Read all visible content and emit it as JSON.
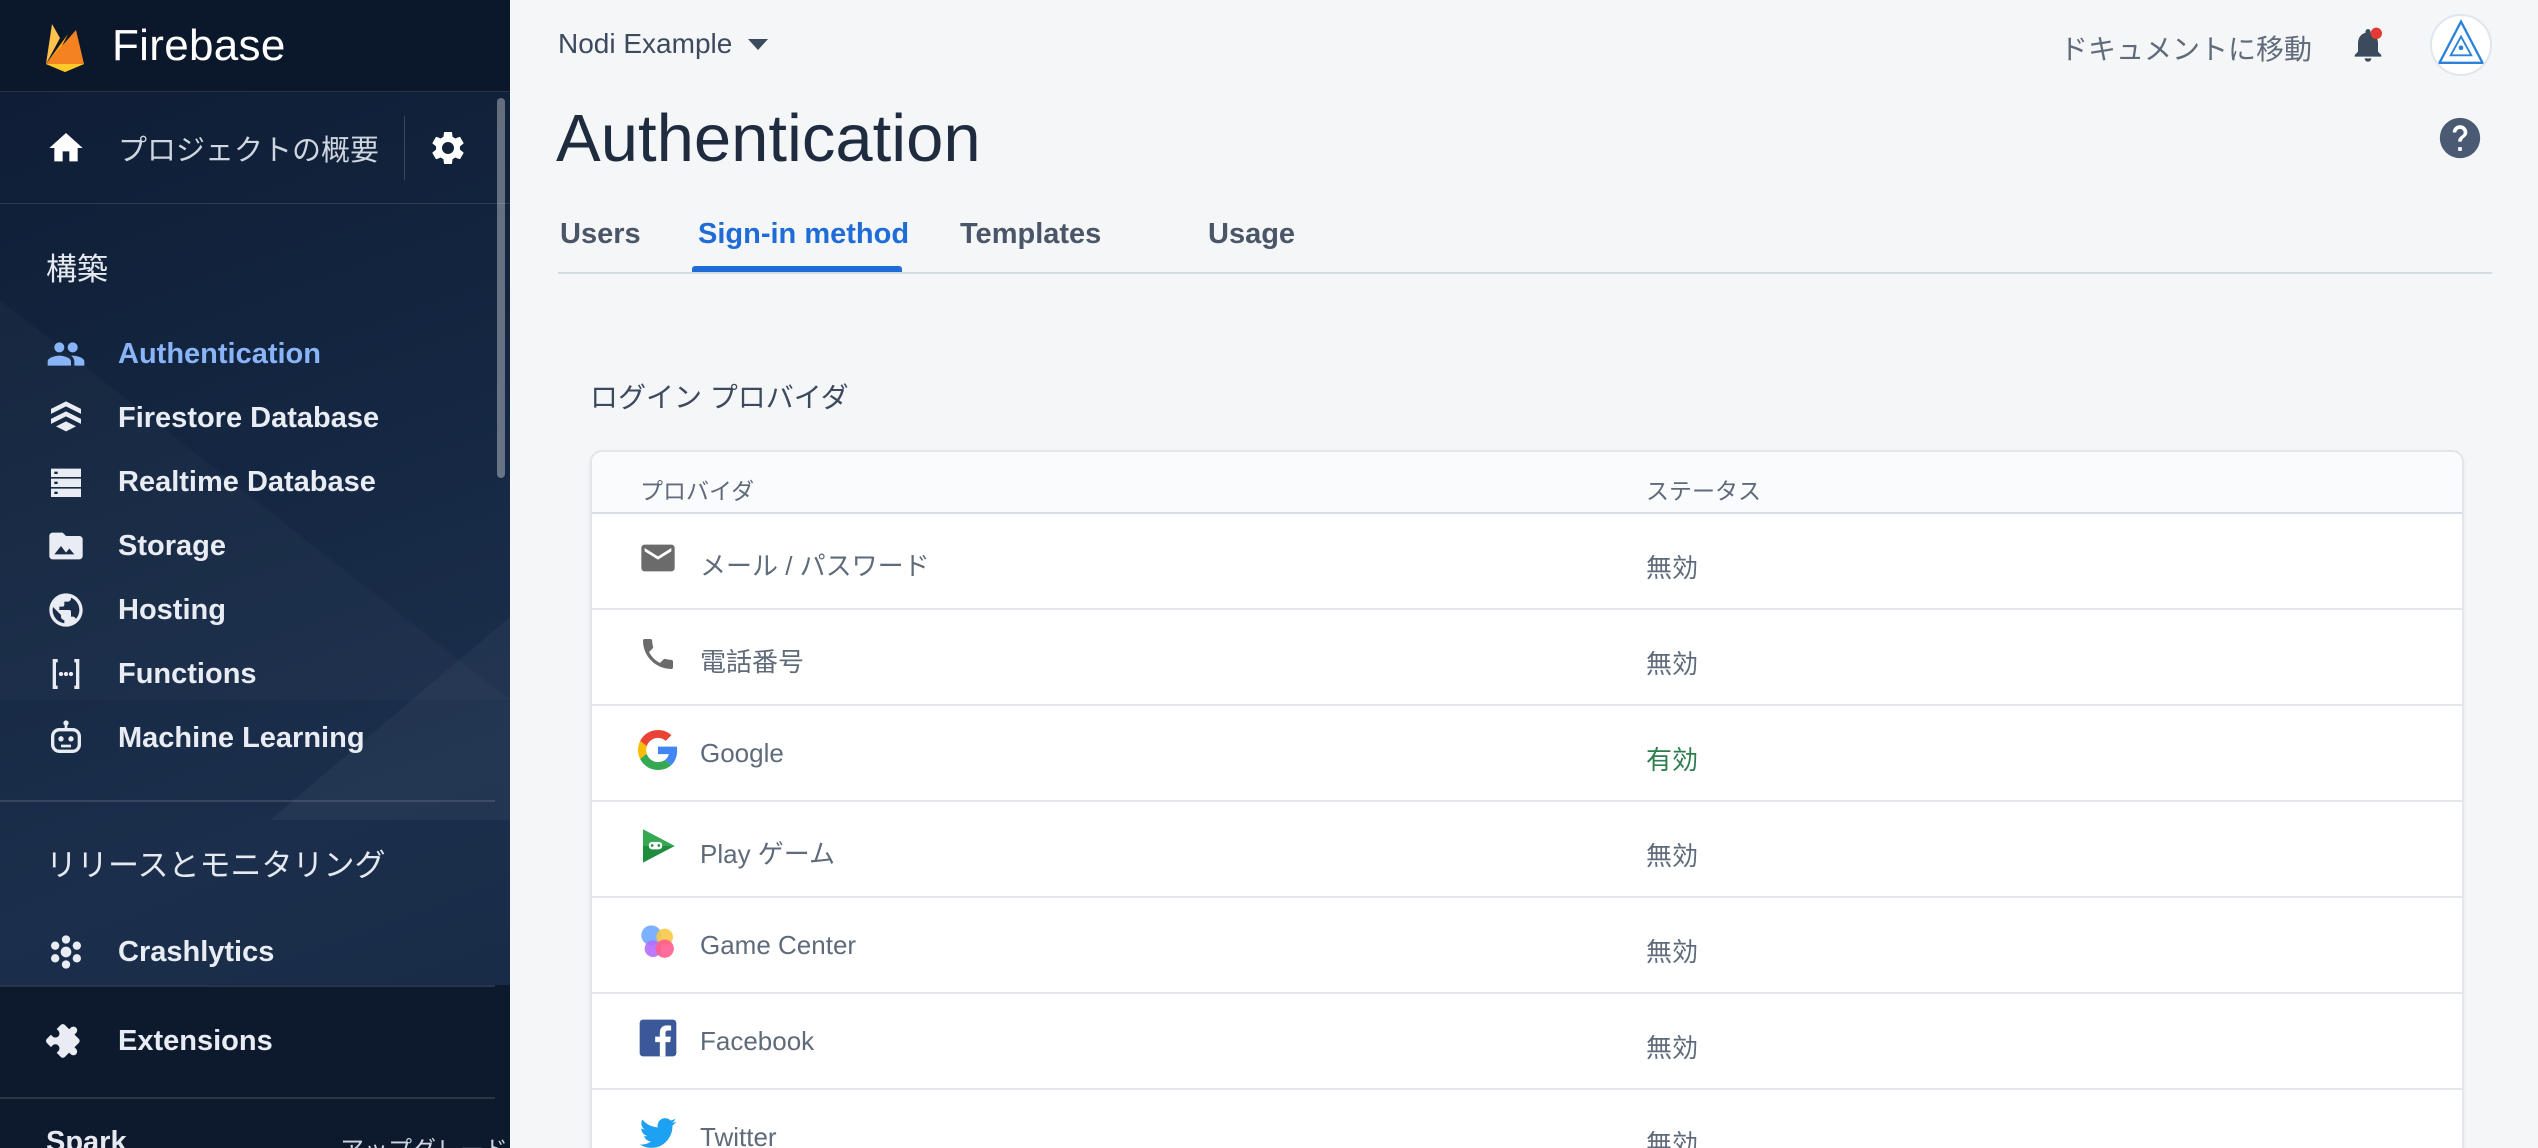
{
  "sidebar": {
    "brand": "Firebase",
    "overview_label": "プロジェクトの概要",
    "section_build": "構築",
    "build_items": [
      {
        "label": "Authentication",
        "icon": "people-icon",
        "active": true
      },
      {
        "label": "Firestore Database",
        "icon": "firestore-icon"
      },
      {
        "label": "Realtime Database",
        "icon": "database-icon"
      },
      {
        "label": "Storage",
        "icon": "image-icon"
      },
      {
        "label": "Hosting",
        "icon": "globe-icon"
      },
      {
        "label": "Functions",
        "icon": "functions-icon"
      },
      {
        "label": "Machine Learning",
        "icon": "robot-icon"
      }
    ],
    "section_release": "リリースとモニタリング",
    "release_items": [
      {
        "label": "Crashlytics",
        "icon": "crashlytics-icon"
      }
    ],
    "extensions_label": "Extensions",
    "plan_label": "Spark",
    "plan_action": "アップグレード"
  },
  "header": {
    "project_name": "Nodi Example",
    "docs_link": "ドキュメントに移動"
  },
  "page": {
    "title": "Authentication",
    "tabs": [
      "Users",
      "Sign-in method",
      "Templates",
      "Usage"
    ],
    "active_tab": "Sign-in method"
  },
  "providers": {
    "section_title": "ログイン プロバイダ",
    "col_provider": "プロバイダ",
    "col_status": "ステータス",
    "rows": [
      {
        "name": "メール / パスワード",
        "icon": "email-icon",
        "status": "無効"
      },
      {
        "name": "電話番号",
        "icon": "phone-icon",
        "status": "無効"
      },
      {
        "name": "Google",
        "icon": "google-icon",
        "status": "有効"
      },
      {
        "name": "Play ゲーム",
        "icon": "play-games-icon",
        "status": "無効"
      },
      {
        "name": "Game Center",
        "icon": "game-center-icon",
        "status": "無効"
      },
      {
        "name": "Facebook",
        "icon": "facebook-icon",
        "status": "無効"
      },
      {
        "name": "Twitter",
        "icon": "twitter-icon",
        "status": "無効"
      }
    ]
  },
  "colors": {
    "accent": "#1f6cd8",
    "sidebar_active": "#8ab4f8",
    "status_enabled": "#2e7d4f"
  }
}
